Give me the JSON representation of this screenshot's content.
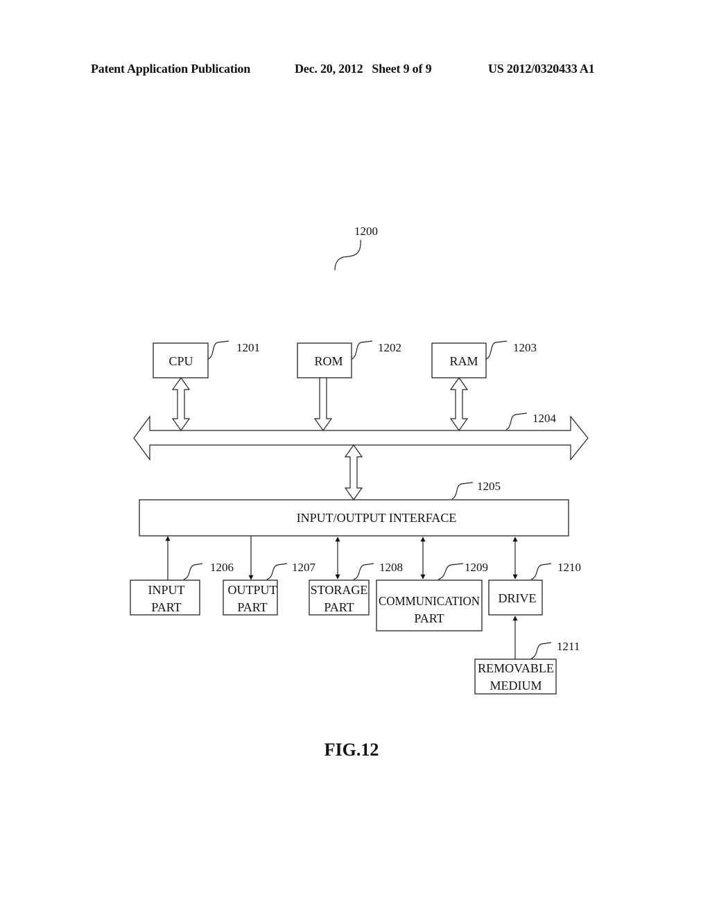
{
  "header": {
    "publication": "Patent Application Publication",
    "date_sheet": "Dec. 20, 2012   Sheet 9 of 9",
    "number": "US 2012/0320433 A1"
  },
  "diagram": {
    "system_ref": "1200",
    "figure_label": "FIG.12",
    "top_blocks": [
      {
        "label": "CPU",
        "ref": "1201",
        "link": "bidirectional"
      },
      {
        "label": "ROM",
        "ref": "1202",
        "link": "to-bus"
      },
      {
        "label": "RAM",
        "ref": "1203",
        "link": "bidirectional"
      }
    ],
    "bus": {
      "ref": "1204"
    },
    "interface": {
      "label": "INPUT/OUTPUT INTERFACE",
      "ref": "1205"
    },
    "bottom_blocks": [
      {
        "line1": "INPUT",
        "line2": "PART",
        "ref": "1206",
        "link": "to-interface"
      },
      {
        "line1": "OUTPUT",
        "line2": "PART",
        "ref": "1207",
        "link": "from-interface"
      },
      {
        "line1": "STORAGE",
        "line2": "PART",
        "ref": "1208",
        "link": "bidirectional"
      },
      {
        "line1": "COMMUNICATION",
        "line2": "PART",
        "ref": "1209",
        "link": "bidirectional"
      },
      {
        "line1": "DRIVE",
        "line2": "",
        "ref": "1210",
        "link": "bidirectional"
      }
    ],
    "removable": {
      "line1": "REMOVABLE",
      "line2": "MEDIUM",
      "ref": "1211",
      "link": "to-drive"
    }
  }
}
